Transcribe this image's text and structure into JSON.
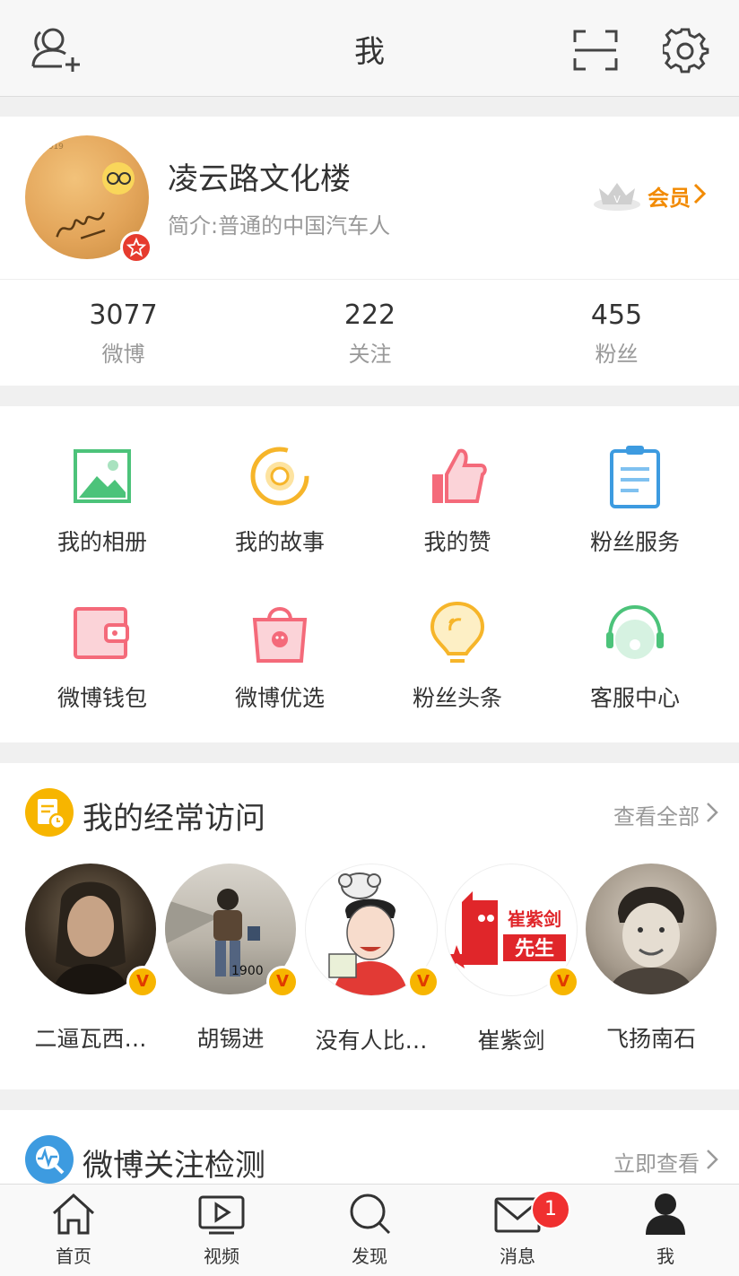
{
  "header": {
    "title": "我"
  },
  "profile": {
    "name": "凌云路文化楼",
    "bio": "简介:普通的中国汽车人",
    "member_label": "会员",
    "avatar_text": "2019"
  },
  "stats": [
    {
      "value": "3077",
      "label": "微博"
    },
    {
      "value": "222",
      "label": "关注"
    },
    {
      "value": "455",
      "label": "粉丝"
    }
  ],
  "grid": [
    {
      "label": "我的相册",
      "icon": "album-icon"
    },
    {
      "label": "我的故事",
      "icon": "story-icon"
    },
    {
      "label": "我的赞",
      "icon": "thumbs-up-icon"
    },
    {
      "label": "粉丝服务",
      "icon": "clipboard-icon"
    },
    {
      "label": "微博钱包",
      "icon": "wallet-icon"
    },
    {
      "label": "微博优选",
      "icon": "shopping-bag-icon"
    },
    {
      "label": "粉丝头条",
      "icon": "lightbulb-icon"
    },
    {
      "label": "客服中心",
      "icon": "headset-icon"
    }
  ],
  "frequent": {
    "title": "我的经常访问",
    "more": "查看全部",
    "people": [
      {
        "name": "二逼瓦西…",
        "verified_mark": "V"
      },
      {
        "name": "胡锡进",
        "verified_mark": "V"
      },
      {
        "name": "没有人比…",
        "verified_mark": "V"
      },
      {
        "name": "崔紫剑",
        "verified_mark": "V",
        "avatar_text_1": "崔紫剑",
        "avatar_text_2": "先生"
      },
      {
        "name": "飞扬南石"
      }
    ]
  },
  "detect": {
    "title": "微博关注检测",
    "more": "立即查看"
  },
  "tabbar": {
    "tabs": [
      {
        "label": "首页",
        "icon": "home-icon"
      },
      {
        "label": "视频",
        "icon": "video-icon"
      },
      {
        "label": "发现",
        "icon": "search-icon"
      },
      {
        "label": "消息",
        "icon": "mail-icon",
        "badge": "1"
      },
      {
        "label": "我",
        "icon": "person-icon"
      }
    ]
  }
}
